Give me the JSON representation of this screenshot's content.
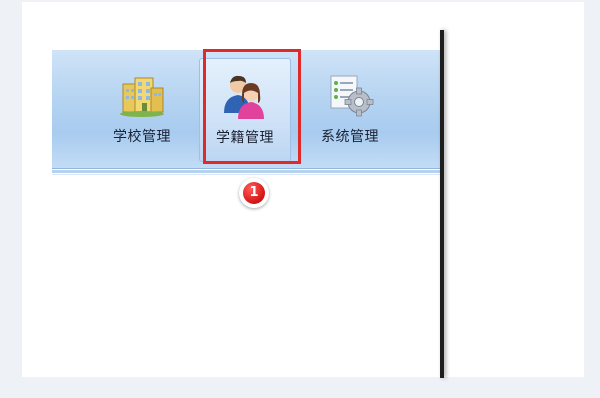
{
  "toolbar": {
    "buttons": [
      {
        "label": "学校管理",
        "icon": "school-building-icon"
      },
      {
        "label": "学籍管理",
        "icon": "students-icon"
      },
      {
        "label": "系统管理",
        "icon": "system-settings-icon"
      }
    ]
  },
  "annotation": {
    "step_number": "1",
    "highlight_color": "#e02a2a"
  }
}
